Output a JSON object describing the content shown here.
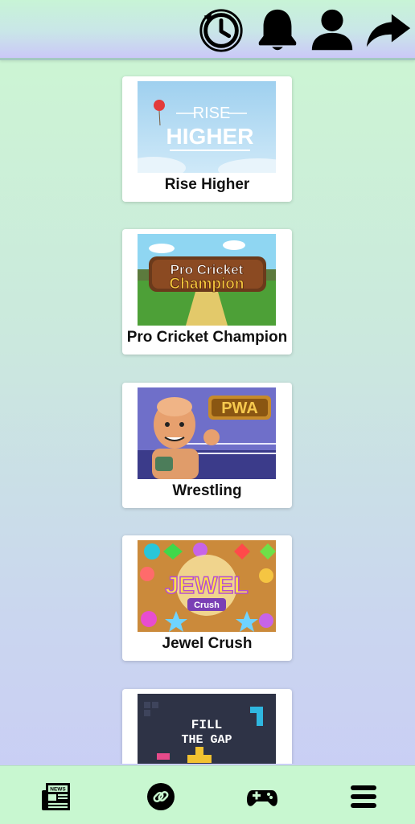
{
  "header": {
    "icons": [
      "history-icon",
      "notification-bell-icon",
      "user-profile-icon",
      "share-icon"
    ]
  },
  "games": [
    {
      "title": "Rise Higher",
      "thumb_text_1": "RISE",
      "thumb_text_2": "HIGHER"
    },
    {
      "title": "Pro Cricket Champion",
      "thumb_text_1": "Pro Cricket",
      "thumb_text_2": "Champion"
    },
    {
      "title": "Wrestling",
      "thumb_text_1": "PWA"
    },
    {
      "title": "Jewel Crush",
      "thumb_text_1": "JEWEL",
      "thumb_text_2": "Crush"
    },
    {
      "title": "",
      "thumb_text_1": "FILL",
      "thumb_text_2": "THE GAP"
    }
  ],
  "bottom_nav": {
    "items": [
      "news-icon",
      "link-icon",
      "gamepad-icon",
      "menu-icon"
    ],
    "news_badge": "NEWS"
  },
  "colors": {
    "top_gradient_start": "#c8f4d6",
    "top_gradient_end": "#cbc8f7",
    "bottom_bar": "#c8f7d0",
    "card": "#ffffff"
  }
}
